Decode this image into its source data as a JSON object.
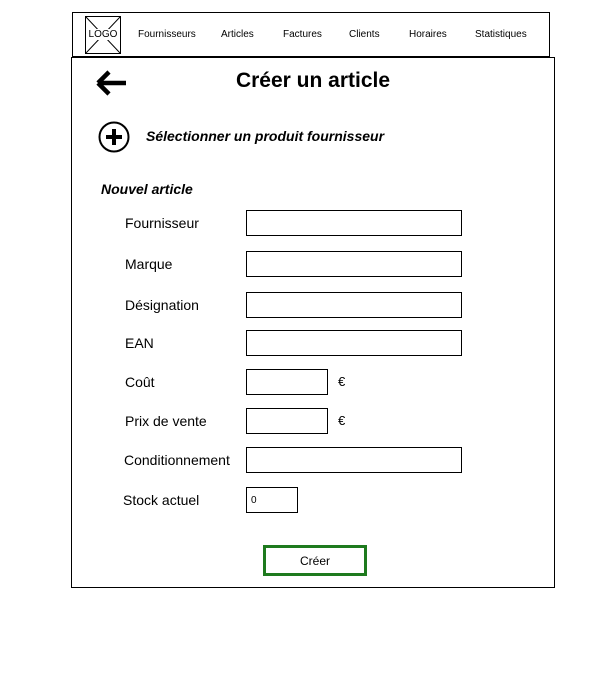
{
  "navbar": {
    "logo_text": "LOGO",
    "items": [
      {
        "label": "Fournisseurs"
      },
      {
        "label": "Articles"
      },
      {
        "label": "Factures"
      },
      {
        "label": "Clients"
      },
      {
        "label": "Horaires"
      },
      {
        "label": "Statistiques"
      }
    ]
  },
  "page": {
    "title": "Créer un article",
    "back_icon": "arrow-left-icon",
    "select_product_icon": "plus-circle-icon",
    "select_product_label": "Sélectionner un produit fournisseur",
    "section_title": "Nouvel article"
  },
  "form": {
    "fields": [
      {
        "label": "Fournisseur",
        "value": ""
      },
      {
        "label": "Marque",
        "value": ""
      },
      {
        "label": "Désignation",
        "value": ""
      },
      {
        "label": "EAN",
        "value": ""
      },
      {
        "label": "Coût",
        "value": "",
        "suffix": "€"
      },
      {
        "label": "Prix de vente",
        "value": "",
        "suffix": "€"
      },
      {
        "label": "Conditionnement",
        "value": ""
      },
      {
        "label": "Stock actuel",
        "value": "0"
      }
    ],
    "submit_label": "Créer"
  },
  "colors": {
    "submit_border": "#1e7a1e"
  }
}
